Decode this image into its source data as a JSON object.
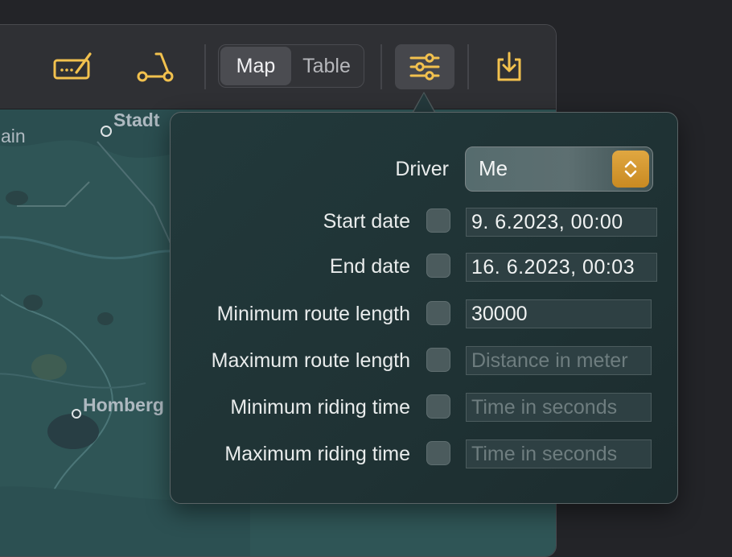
{
  "toolbar": {
    "edit_icon": "signature-edit-icon",
    "scooter_icon": "scooter-icon",
    "segments": [
      {
        "label": "Map",
        "selected": true
      },
      {
        "label": "Table",
        "selected": false
      }
    ],
    "filter_icon": "sliders-icon",
    "export_icon": "download-tray-icon"
  },
  "map": {
    "labels": {
      "top": "Stadt",
      "left": "ain",
      "middle": "Homberg"
    }
  },
  "filter_popover": {
    "driver": {
      "label": "Driver",
      "value": "Me"
    },
    "rows": [
      {
        "label": "Start date",
        "checked": false,
        "value": " 9. 6.2023, 00:00",
        "placeholder": ""
      },
      {
        "label": "End date",
        "checked": false,
        "value": "16. 6.2023, 00:03",
        "placeholder": ""
      },
      {
        "label": "Minimum route length",
        "checked": false,
        "value": "30000",
        "placeholder": ""
      },
      {
        "label": "Maximum route length",
        "checked": false,
        "value": "",
        "placeholder": "Distance in meter"
      },
      {
        "label": "Minimum riding time",
        "checked": false,
        "value": "",
        "placeholder": "Time in seconds"
      },
      {
        "label": "Maximum riding time",
        "checked": false,
        "value": "",
        "placeholder": "Time in seconds"
      }
    ]
  },
  "colors": {
    "accent": "#f2c14e",
    "stepper": "#d69a30",
    "map_base": "#2f5556"
  }
}
